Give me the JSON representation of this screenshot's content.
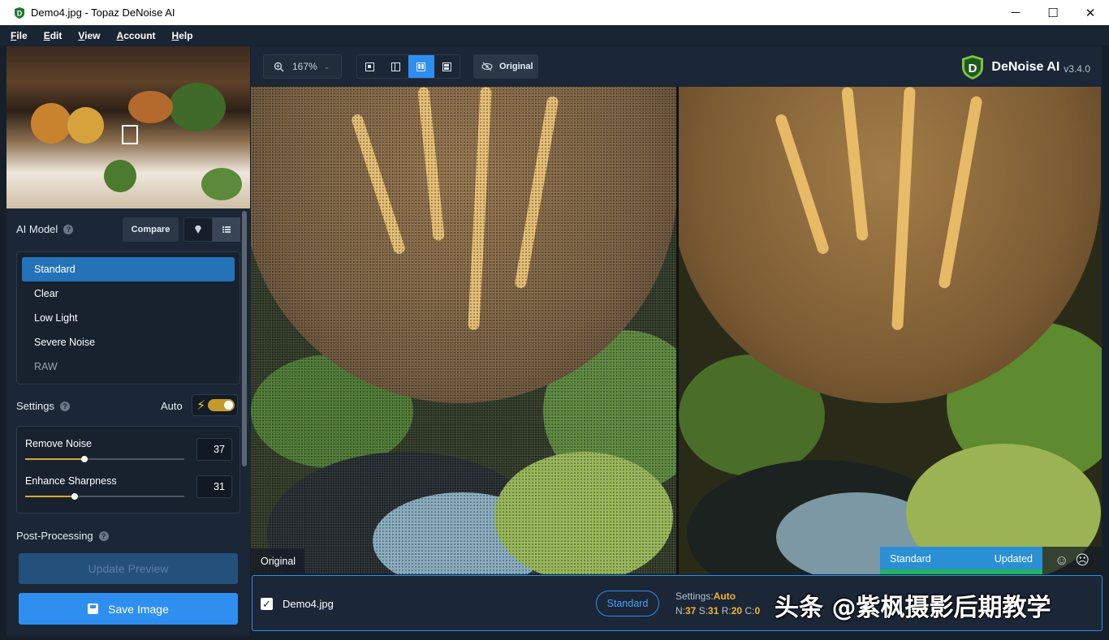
{
  "window": {
    "title": "Demo4.jpg - Topaz DeNoise AI",
    "controls": {
      "minimize": "─",
      "maximize": "☐",
      "close": "✕"
    }
  },
  "menu": [
    {
      "label": "File",
      "underline": "F",
      "rest": "ile"
    },
    {
      "label": "Edit",
      "underline": "E",
      "rest": "dit"
    },
    {
      "label": "View",
      "underline": "V",
      "rest": "iew"
    },
    {
      "label": "Account",
      "underline": "A",
      "rest": "ccount"
    },
    {
      "label": "Help",
      "underline": "H",
      "rest": "elp"
    }
  ],
  "sidebar": {
    "ai_model_label": "AI Model",
    "compare_label": "Compare",
    "models": [
      "Standard",
      "Clear",
      "Low Light",
      "Severe Noise",
      "RAW"
    ],
    "selected_model": "Standard",
    "settings_label": "Settings",
    "auto_label": "Auto",
    "auto_on": true,
    "sliders": [
      {
        "label": "Remove Noise",
        "value": "37",
        "fraction": 0.37
      },
      {
        "label": "Enhance Sharpness",
        "value": "31",
        "fraction": 0.31
      }
    ],
    "post_processing_label": "Post-Processing",
    "update_preview_label": "Update Preview",
    "save_image_label": "Save Image"
  },
  "toolbar": {
    "zoom": "167%",
    "original_label": "Original",
    "brand_name": "DeNoise AI",
    "version": "v3.4.0",
    "selected_view_mode": 3
  },
  "preview": {
    "left_tag": "Original",
    "right_model": "Standard",
    "right_status": "Updated"
  },
  "filebar": {
    "filename": "Demo4.jpg",
    "checked": true,
    "model": "Standard",
    "settings_prefix": "Settings:",
    "settings_mode": "Auto",
    "n_label": "N:",
    "n_value": "37",
    "s_label": "S:",
    "s_value": "31",
    "r_label": "R:",
    "r_value": "20",
    "c_label": "C:",
    "c_value": "0"
  },
  "watermark": "头条 @紫枫摄影后期教学",
  "colors": {
    "accent": "#2e8ff0",
    "auto_yellow": "#f3b632",
    "status_green": "#26b35c"
  }
}
